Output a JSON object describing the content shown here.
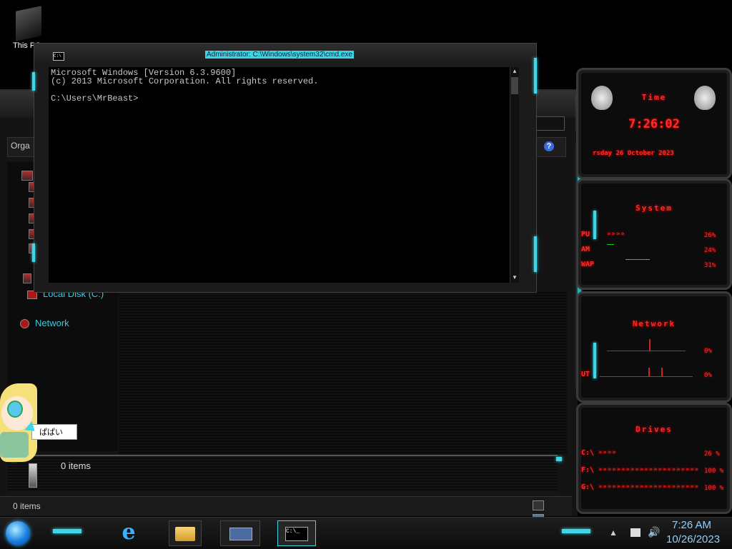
{
  "desktop": {
    "icon_label": "This PC"
  },
  "explorer": {
    "organize_label": "Orga",
    "nav": {
      "local_disk": "Local Disk (C:)",
      "network": "Network"
    },
    "details_items": "0 items",
    "status_items": "0 items"
  },
  "cmd": {
    "title": "Administrator: C:\\Windows\\system32\\cmd.exe",
    "icon_text": "C:\\",
    "lines": [
      "Microsoft Windows [Version 6.3.9600]",
      "(c) 2013 Microsoft Corporation. All rights reserved.",
      "",
      "C:\\Users\\MrBeast>"
    ]
  },
  "gadgets": {
    "time": {
      "title": "Time",
      "clock": "7:26:02",
      "date": "rsday 26 October 2023"
    },
    "system": {
      "title": "System",
      "rows": [
        {
          "label": "PU",
          "arrows": "»»»»",
          "value": "26%"
        },
        {
          "label": "AM",
          "arrows": "",
          "value": "24%"
        },
        {
          "label": "WAP",
          "arrows": "",
          "value": "31%"
        }
      ]
    },
    "network": {
      "title": "Network",
      "rows": [
        {
          "label": "",
          "value": "0%"
        },
        {
          "label": "UT",
          "value": "0%"
        }
      ]
    },
    "drives": {
      "title": "Drives",
      "rows": [
        {
          "label": "C:\\",
          "arrows": "»»»»",
          "value": "26 %"
        },
        {
          "label": "F:\\",
          "arrows": "»»»»»»»»»»»»»»»»»»»»»»»»",
          "value": "100 %"
        },
        {
          "label": "G:\\",
          "arrows": "»»»»»»»»»»»»»»»»»»»»»»»»",
          "value": "100 %"
        }
      ]
    }
  },
  "character": {
    "speech": "ぱぱい"
  },
  "taskbar": {
    "time": "7:26 AM",
    "date": "10/26/2023",
    "cmd_icon_text": "C:\\_"
  },
  "colors": {
    "accent": "#3fd7e8",
    "gadget_red": "#ff2a2a",
    "clock_text": "#8fd0ff"
  },
  "icons": [
    "start-orb-icon",
    "internet-explorer-icon",
    "file-explorer-icon",
    "cmd-icon",
    "volume-icon",
    "network-flag-icon"
  ]
}
